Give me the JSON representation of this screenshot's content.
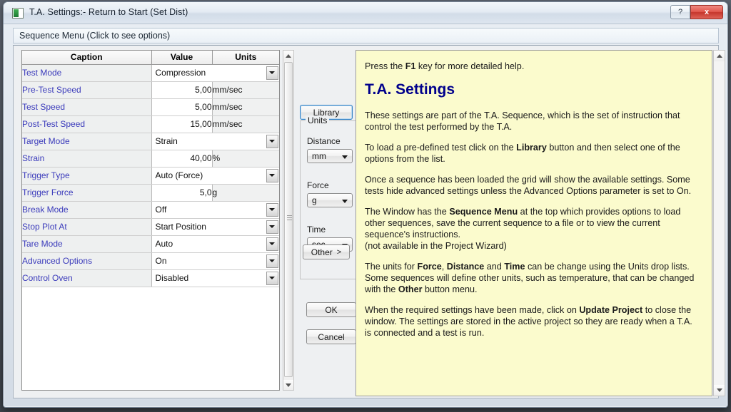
{
  "window": {
    "title": "T.A. Settings:- Return to Start (Set Dist)",
    "app_icon": "app-icon",
    "help_button": "?",
    "close_button": "x"
  },
  "menubar": {
    "label": "Sequence Menu (Click to see options)"
  },
  "grid": {
    "columns": [
      "Caption",
      "Value",
      "Units"
    ],
    "rows": [
      {
        "caption": "Test Mode",
        "value": "Compression",
        "units": "",
        "kind": "combo"
      },
      {
        "caption": "Pre-Test Speed",
        "value": "5,00",
        "units": "mm/sec",
        "kind": "number"
      },
      {
        "caption": "Test Speed",
        "value": "5,00",
        "units": "mm/sec",
        "kind": "number"
      },
      {
        "caption": "Post-Test Speed",
        "value": "15,00",
        "units": "mm/sec",
        "kind": "number"
      },
      {
        "caption": "Target Mode",
        "value": "Strain",
        "units": "",
        "kind": "combo"
      },
      {
        "caption": "Strain",
        "value": "40,00",
        "units": "%",
        "kind": "number"
      },
      {
        "caption": "Trigger Type",
        "value": "Auto (Force)",
        "units": "",
        "kind": "combo"
      },
      {
        "caption": "Trigger Force",
        "value": "5,0",
        "units": "g",
        "kind": "number"
      },
      {
        "caption": "Break Mode",
        "value": "Off",
        "units": "",
        "kind": "combo"
      },
      {
        "caption": "Stop Plot At",
        "value": "Start Position",
        "units": "",
        "kind": "combo"
      },
      {
        "caption": "Tare Mode",
        "value": "Auto",
        "units": "",
        "kind": "combo"
      },
      {
        "caption": "Advanced Options",
        "value": "On",
        "units": "",
        "kind": "combo"
      },
      {
        "caption": "Control Oven",
        "value": "Disabled",
        "units": "",
        "kind": "combo"
      }
    ]
  },
  "controls": {
    "library_button": "Library",
    "units_group_title": "Units",
    "distance_label": "Distance",
    "distance_value": "mm",
    "force_label": "Force",
    "force_value": "g",
    "time_label": "Time",
    "time_value": "sec",
    "other_button": "Other",
    "other_chevron": ">",
    "ok_button": "OK",
    "cancel_button": "Cancel"
  },
  "help": {
    "intro_before": "Press the ",
    "intro_bold": "F1",
    "intro_after": " key for more detailed help.",
    "heading": "T.A. Settings",
    "p1": "These settings are part of the T.A. Sequence, which is the set of instruction that control the test performed by the T.A.",
    "p2_a": "To load a pre-defined test click on the ",
    "p2_bold": "Library",
    "p2_b": " button and then select one of the options from the list.",
    "p3": "Once a sequence has been loaded the grid will show the available settings. Some tests hide advanced settings unless the Advanced Options parameter is set to On.",
    "p4_a": "The Window has the ",
    "p4_bold": "Sequence Menu",
    "p4_b": " at the top which provides options to load other sequences, save the current sequence to a file or to view the current sequence's instructions.",
    "p4_c": "(not available in the Project Wizard)",
    "p5_a": "The units for ",
    "p5_bold1": "Force",
    "p5_b": ", ",
    "p5_bold2": "Distance",
    "p5_c": " and ",
    "p5_bold3": "Time",
    "p5_d": " can be change using the Units drop lists. Some sequences will define other units, such as temperature, that can be changed with the ",
    "p5_bold4": "Other",
    "p5_e": " button menu.",
    "p6_a": "When the required settings have been made, click on ",
    "p6_bold": "Update Project",
    "p6_b": " to close the window. The settings are stored in the active project so they are ready when a T.A. is connected and a test is run."
  },
  "colors": {
    "help_background": "#fbfbcd",
    "heading": "#00008c",
    "caption_text": "#3b3bbb",
    "close_button": "#c5362c",
    "focus_border": "#2f7fc4"
  }
}
